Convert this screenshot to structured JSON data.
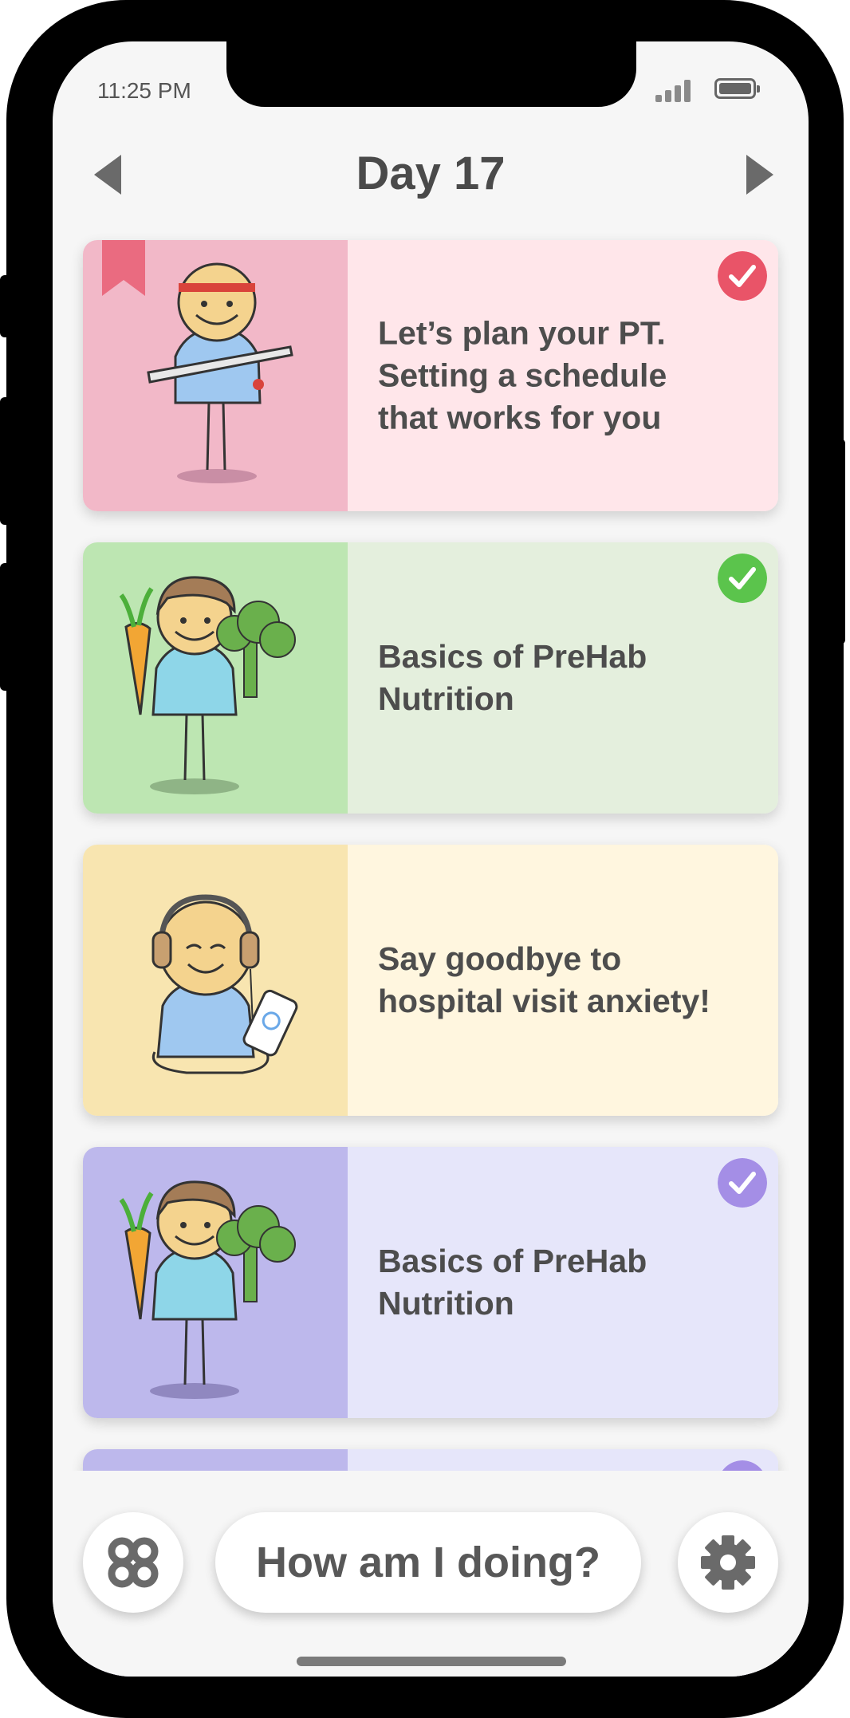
{
  "status_bar": {
    "time": "11:25 PM",
    "signal_icon": "signal-icon",
    "battery_icon": "battery-icon"
  },
  "header": {
    "title": "Day 17",
    "prev_icon": "chevron-left-icon",
    "next_icon": "chevron-right-icon"
  },
  "cards": [
    {
      "title": "Let’s plan your PT.\nSetting a schedule\nthat works for you",
      "illustration": "stick-figure-with-bar-illustration",
      "completed": true,
      "bookmarked": true,
      "illus_color": "#f2b8c8",
      "content_color": "#ffe6ea",
      "check_color": "#e95468"
    },
    {
      "title": "Basics of PreHab\nNutrition",
      "illustration": "stick-figure-with-carrot-and-broccoli-illustration",
      "completed": true,
      "bookmarked": false,
      "illus_color": "#bde6b2",
      "content_color": "#e4efdd",
      "check_color": "#5bc44c"
    },
    {
      "title": "Say goodbye to\nhospital visit anxiety!",
      "illustration": "stick-figure-with-headphones-illustration",
      "completed": false,
      "bookmarked": false,
      "illus_color": "#f8e5b0",
      "content_color": "#fff6df"
    },
    {
      "title": "Basics of PreHab\nNutrition",
      "illustration": "stick-figure-with-carrot-and-broccoli-illustration",
      "completed": true,
      "bookmarked": false,
      "illus_color": "#bdb8ec",
      "content_color": "#e6e6fa",
      "check_color": "#a48ee6"
    }
  ],
  "bottom_nav": {
    "menu_icon": "clover-menu-icon",
    "progress_label": "How am I doing?",
    "settings_icon": "gear-icon"
  },
  "colors": {
    "background": "#f6f6f6",
    "text_dark": "#4d4d4d",
    "device_frame": "#000000"
  }
}
